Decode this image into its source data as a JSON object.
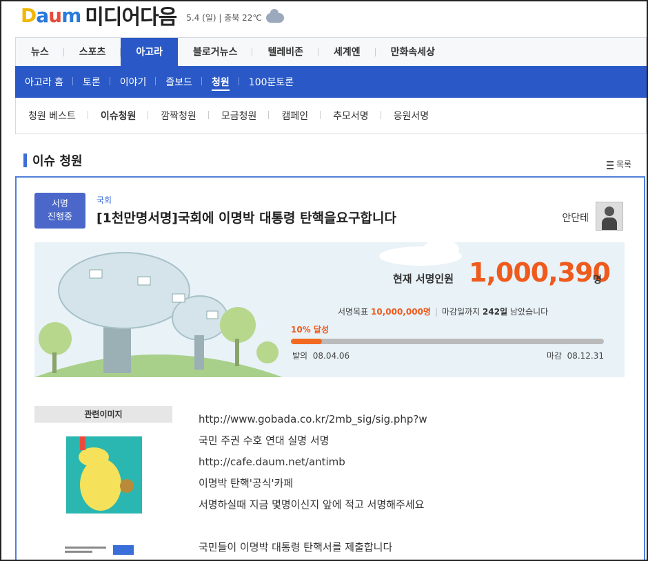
{
  "header": {
    "logo": {
      "d": "D",
      "a": "a",
      "u": "u",
      "m": "m"
    },
    "site_name": "미디어다음",
    "date": "5.4 (일)",
    "weather": "충북 22℃"
  },
  "main_nav": [
    "뉴스",
    "스포츠",
    "아고라",
    "블로거뉴스",
    "텔레비존",
    "세계엔",
    "만화속세상"
  ],
  "main_nav_active": 2,
  "sub_nav": [
    "아고라 홈",
    "토론",
    "이야기",
    "즐보드",
    "청원",
    "100분토론"
  ],
  "sub_nav_active": 4,
  "third_nav": [
    "청원 베스트",
    "이슈청원",
    "깜짝청원",
    "모금청원",
    "캠페인",
    "추모서명",
    "응원서명"
  ],
  "third_nav_active": 1,
  "section": {
    "title": "이슈 청원",
    "list_label": "목록"
  },
  "petition": {
    "badge_line1": "서명",
    "badge_line2": "진행중",
    "category": "국회",
    "title": "[1천만명서명]국회에 이명박 대통령 탄핵을요구합니다",
    "author": "안단테",
    "current_label": "현재 서명인원",
    "current_value": "1,000,390",
    "current_unit": "명",
    "goal_label": "서명목표",
    "goal_value": "10,000,000명",
    "deadline_label": "마감일까지",
    "days_left": "242일",
    "days_suffix": "남았습니다",
    "progress_label": "10% 달성",
    "progress_fraction": 0.1,
    "start_label": "발의",
    "start_date": "08.04.06",
    "end_label": "마감",
    "end_date": "08.12.31"
  },
  "related": {
    "header": "관련이미지"
  },
  "content_lines": [
    "http://www.gobada.co.kr/2mb_sig/sig.php?w",
    "국민 주권 수호 연대 실명 서명",
    "http://cafe.daum.net/antimb",
    "이명박 탄핵'공식'카페",
    "서명하실때 지금 몇명이신지 앞에 적고 서명해주세요",
    "",
    "국민들이 이명박 대통령 탄핵서를 제출합니다"
  ],
  "colors": {
    "accent": "#2a59c7",
    "orange": "#ef5a1d",
    "panel": "#e8f2f7"
  }
}
